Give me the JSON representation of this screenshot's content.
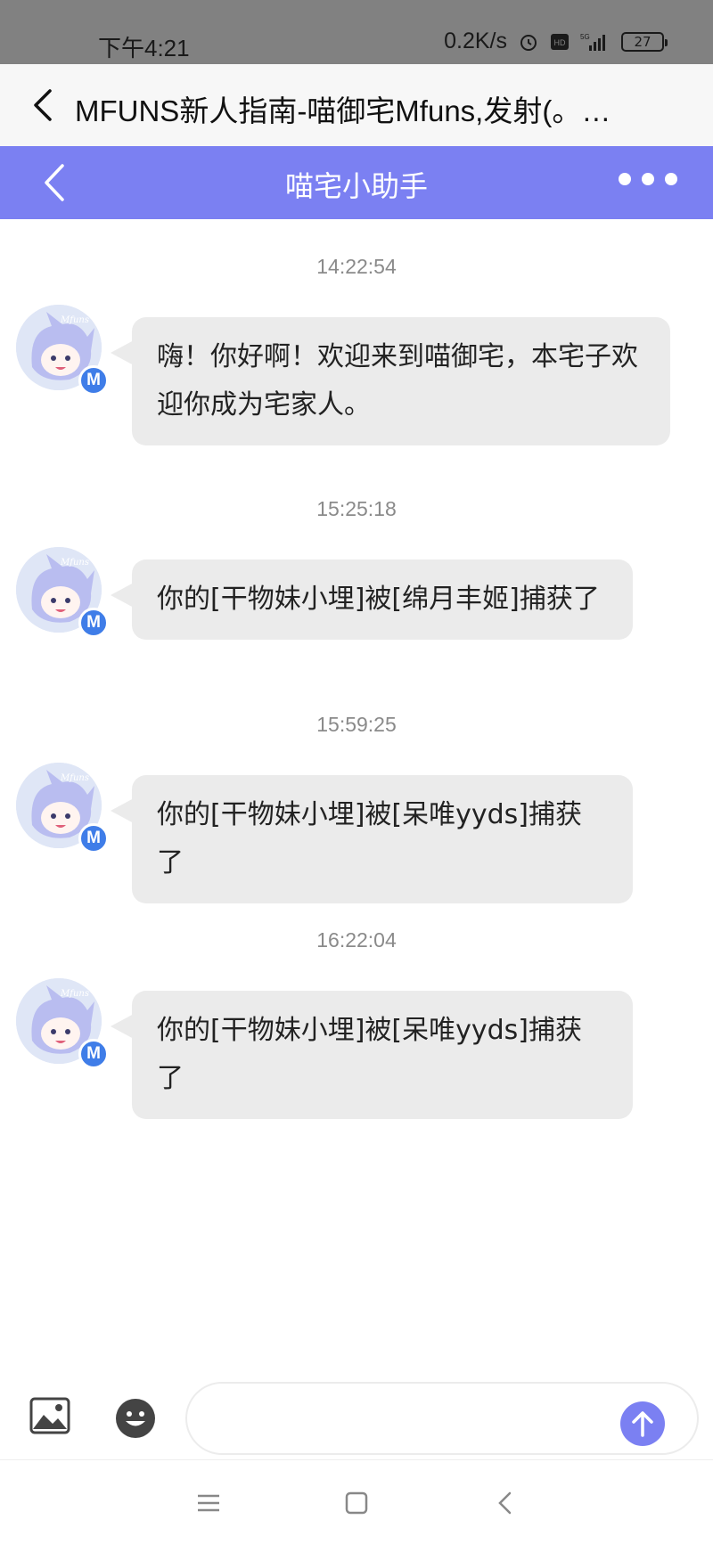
{
  "status_bar": {
    "time": "下午4:21",
    "net_speed": "0.2K/s",
    "battery": "27"
  },
  "app_bar": {
    "title": "MFUNS新人指南-喵御宅Mfuns,发射(。…"
  },
  "chat_header": {
    "name": "喵宅小助手"
  },
  "messages": [
    {
      "timestamp": "14:22:54",
      "text": "嗨！你好啊！欢迎来到喵御宅，本宅子欢迎你成为宅家人。"
    },
    {
      "timestamp": "15:25:18",
      "text": "你的[干物妹小埋]被[绵月丰姬]捕获了"
    },
    {
      "timestamp": "15:59:25",
      "text": "你的[干物妹小埋]被[呆唯yyds]捕获了"
    },
    {
      "timestamp": "16:22:04",
      "text": "你的[干物妹小埋]被[呆唯yyds]捕获了"
    }
  ],
  "avatar": {
    "badge": "M",
    "label": "Mfuns"
  },
  "colors": {
    "accent": "#7b80f2",
    "bubble": "#ebebeb",
    "badge": "#3f7de8"
  },
  "icons": [
    "back-icon",
    "more-icon",
    "image-icon",
    "emoji-icon",
    "send-arrow-icon",
    "menu-icon",
    "home-icon",
    "nav-back-icon"
  ]
}
